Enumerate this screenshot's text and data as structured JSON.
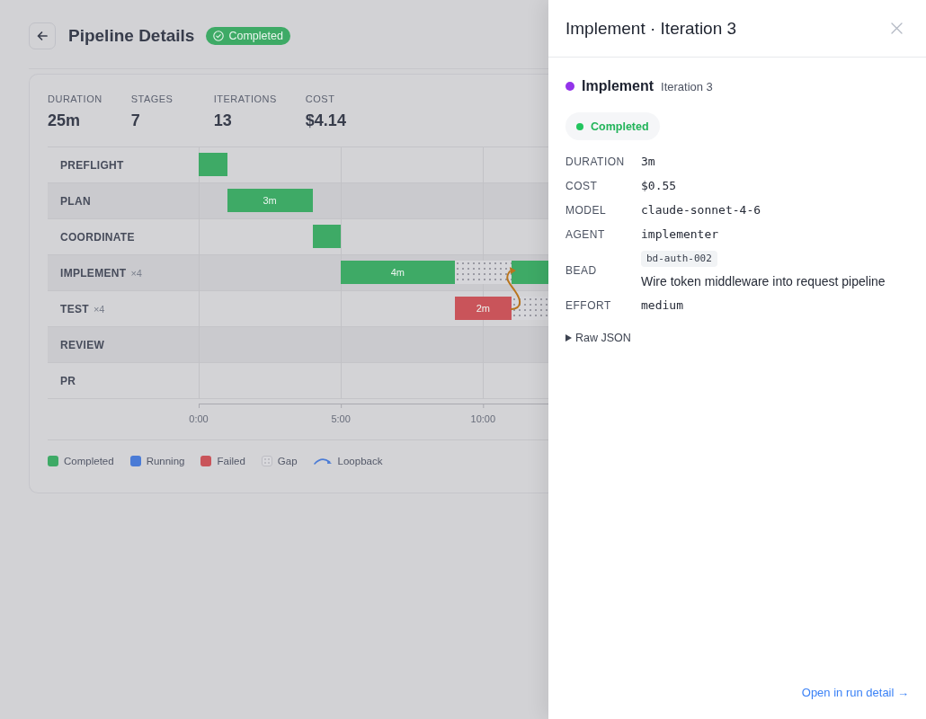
{
  "header": {
    "title": "Pipeline Details",
    "status": {
      "label": "Completed",
      "kind": "completed"
    }
  },
  "stats": [
    {
      "label": "DURATION",
      "value": "25m"
    },
    {
      "label": "STAGES",
      "value": "7"
    },
    {
      "label": "ITERATIONS",
      "value": "13"
    },
    {
      "label": "COST",
      "value": "$4.14"
    }
  ],
  "timeline": {
    "rows": [
      {
        "label": "PREFLIGHT",
        "bars": [
          {
            "kind": "completed"
          }
        ]
      },
      {
        "label": "PLAN",
        "bars": [
          {
            "kind": "completed",
            "label": "3m"
          }
        ]
      },
      {
        "label": "COORDINATE",
        "bars": [
          {
            "kind": "completed"
          }
        ]
      },
      {
        "label": "IMPLEMENT",
        "count": "×4",
        "bars": [
          {
            "kind": "completed",
            "label": "4m"
          },
          {
            "kind": "gap"
          },
          {
            "kind": "completed"
          }
        ]
      },
      {
        "label": "TEST",
        "count": "×4",
        "bars": [
          {
            "kind": "failed",
            "label": "2m"
          },
          {
            "kind": "gap"
          }
        ]
      },
      {
        "label": "REVIEW"
      },
      {
        "label": "PR"
      }
    ],
    "ticks": [
      "0:00",
      "5:00",
      "10:00"
    ],
    "loopback_arrow": true
  },
  "legend": [
    {
      "label": "Completed",
      "kind": "swatch",
      "color": "#3eaa66"
    },
    {
      "label": "Running",
      "kind": "swatch",
      "color": "#4a7bd6"
    },
    {
      "label": "Failed",
      "kind": "swatch",
      "color": "#c9545a"
    },
    {
      "label": "Gap",
      "kind": "gap"
    },
    {
      "label": "Loopback",
      "kind": "arc",
      "color": "#4a7bd6"
    }
  ],
  "drawer": {
    "title": "Implement · Iteration 3",
    "stage": {
      "name": "Implement",
      "iteration": "Iteration 3",
      "color": "#9333ea"
    },
    "status": {
      "label": "Completed",
      "kind": "completed"
    },
    "details": [
      {
        "label": "DURATION",
        "kind": "text",
        "value": "3m"
      },
      {
        "label": "COST",
        "kind": "text",
        "value": "$0.55"
      },
      {
        "label": "MODEL",
        "kind": "text",
        "value": "claude-sonnet-4-6"
      },
      {
        "label": "AGENT",
        "kind": "text",
        "value": "implementer"
      },
      {
        "label": "BEAD",
        "kind": "bead",
        "chip": "bd-auth-002",
        "value": "Wire token middleware into request pipeline"
      },
      {
        "label": "EFFORT",
        "kind": "text",
        "value": "medium"
      }
    ],
    "raw_json": {
      "label": "Raw JSON",
      "expanded": false
    },
    "footer_link": "Open in run detail →"
  }
}
